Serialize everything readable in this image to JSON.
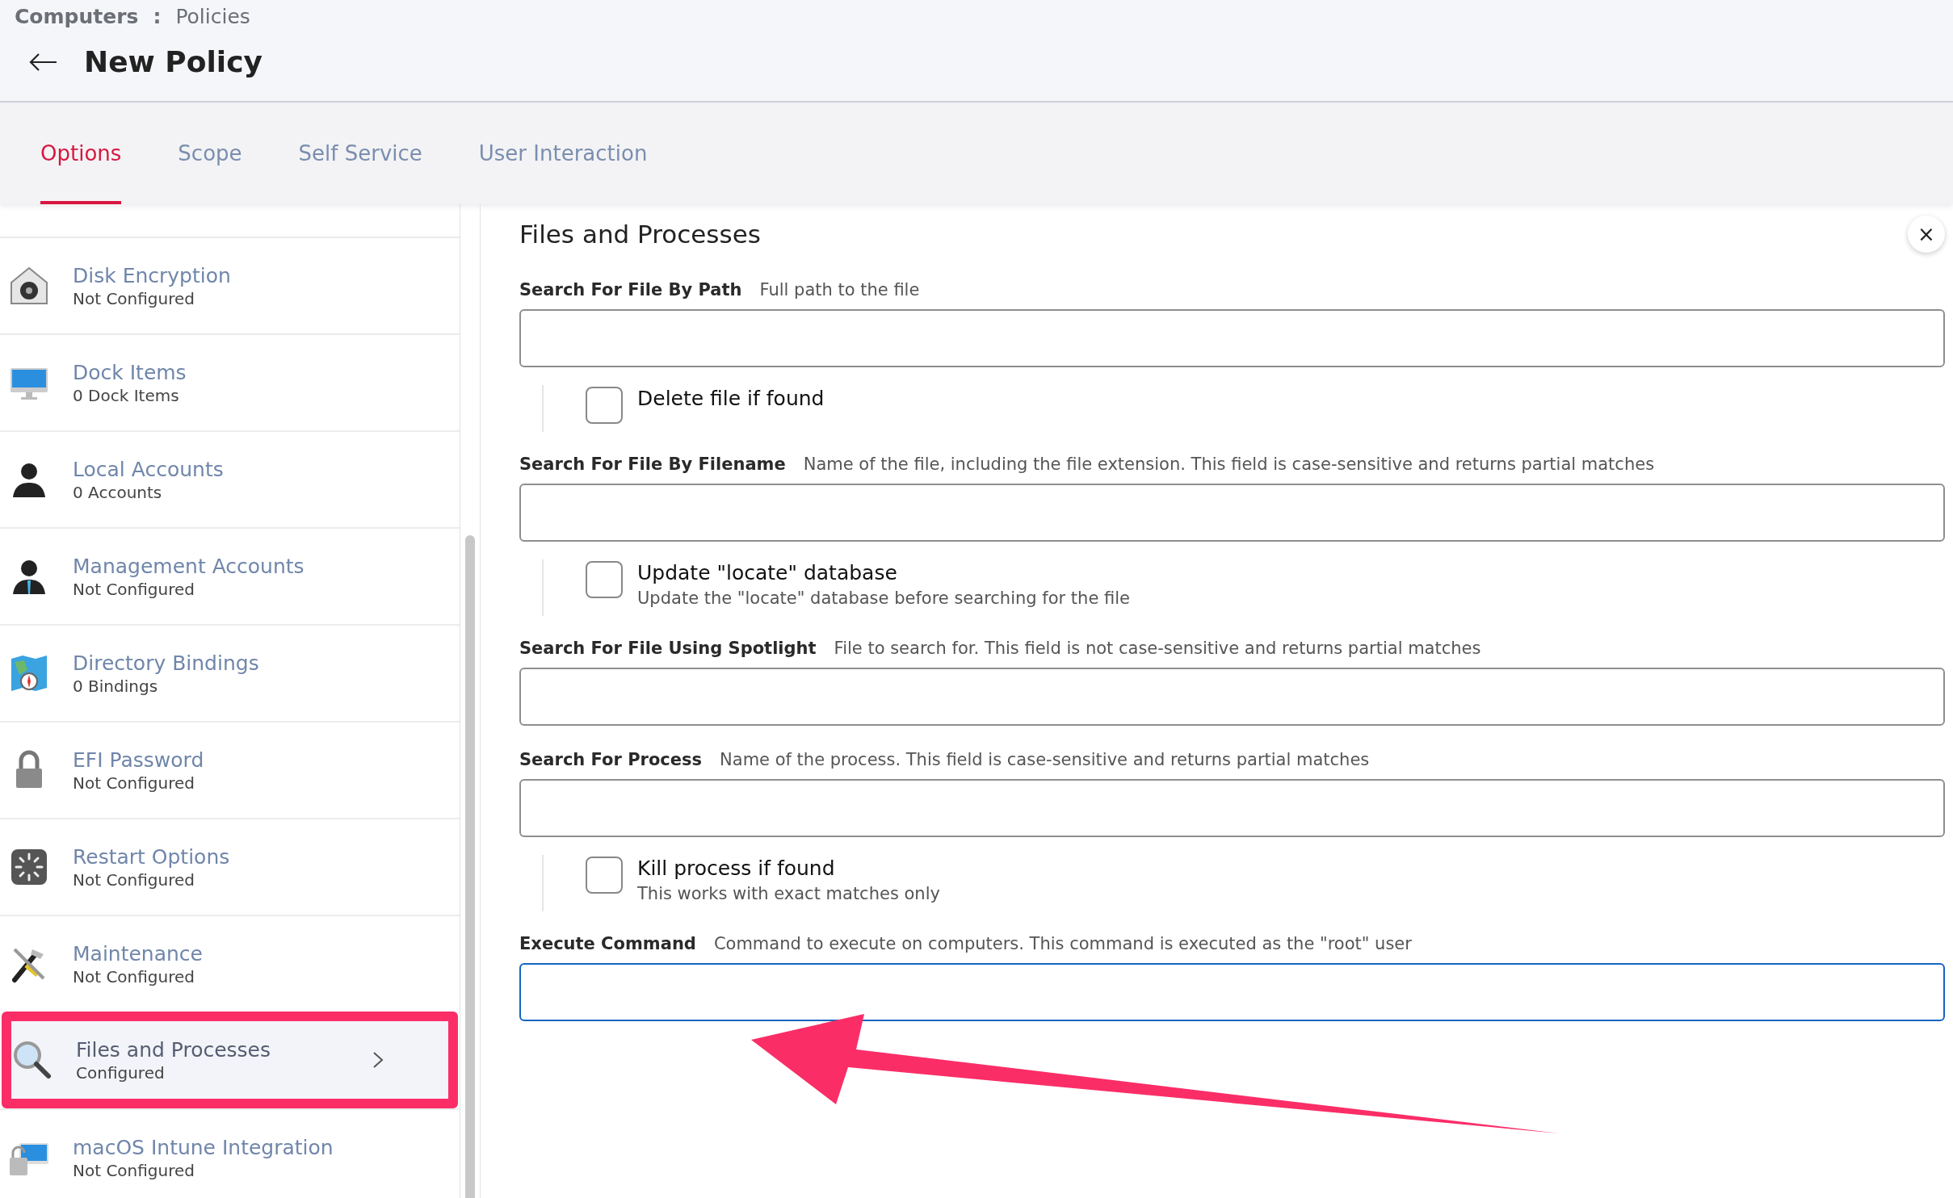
{
  "breadcrumb": {
    "section": "Computers",
    "separator": ":",
    "page": "Policies"
  },
  "title": "New Policy",
  "tabs": [
    {
      "label": "Options",
      "selected": true
    },
    {
      "label": "Scope",
      "selected": false
    },
    {
      "label": "Self Service",
      "selected": false
    },
    {
      "label": "User Interaction",
      "selected": false
    }
  ],
  "sidebar": {
    "items": [
      {
        "title": "Disk Encryption",
        "subtitle": "Not Configured",
        "selected": false
      },
      {
        "title": "Dock Items",
        "subtitle": "0 Dock Items",
        "selected": false
      },
      {
        "title": "Local Accounts",
        "subtitle": "0 Accounts",
        "selected": false
      },
      {
        "title": "Management Accounts",
        "subtitle": "Not Configured",
        "selected": false
      },
      {
        "title": "Directory Bindings",
        "subtitle": "0 Bindings",
        "selected": false
      },
      {
        "title": "EFI Password",
        "subtitle": "Not Configured",
        "selected": false
      },
      {
        "title": "Restart Options",
        "subtitle": "Not Configured",
        "selected": false
      },
      {
        "title": "Maintenance",
        "subtitle": "Not Configured",
        "selected": false
      },
      {
        "title": "Files and Processes",
        "subtitle": "Configured",
        "selected": true
      },
      {
        "title": "macOS Intune Integration",
        "subtitle": "Not Configured",
        "selected": false
      }
    ]
  },
  "panel": {
    "title": "Files and Processes",
    "close": "×",
    "sections": [
      {
        "kind": "field",
        "label": "Search For File By Path",
        "hint": "Full path to the file",
        "focused": false
      },
      {
        "kind": "checkbox",
        "label": "Delete file if found",
        "checked": false
      },
      {
        "kind": "field",
        "label": "Search For File By Filename",
        "hint": "Name of the file, including the file extension. This field is case-sensitive and returns partial matches",
        "focused": false
      },
      {
        "kind": "checkbox",
        "label": "Update \"locate\" database",
        "note": "Update the \"locate\" database before searching for the file",
        "checked": false
      },
      {
        "kind": "field",
        "label": "Search For File Using Spotlight",
        "hint": "File to search for. This field is not case-sensitive and returns partial matches",
        "focused": false
      },
      {
        "kind": "field",
        "label": "Search For Process",
        "hint": "Name of the process. This field is case-sensitive and returns partial matches",
        "focused": false
      },
      {
        "kind": "checkbox",
        "label": "Kill process if found",
        "note": "This works with exact matches only",
        "checked": false
      },
      {
        "kind": "field",
        "label": "Execute Command",
        "hint": "Command to execute on computers. This command is executed as the \"root\" user",
        "focused": true
      }
    ]
  }
}
